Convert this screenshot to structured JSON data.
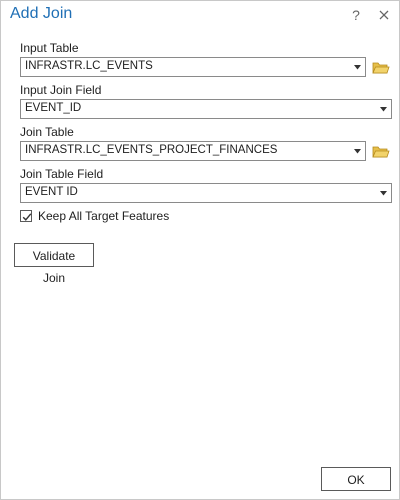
{
  "dialog": {
    "title": "Add Join",
    "help": "?"
  },
  "form": {
    "input_table": {
      "label": "Input Table",
      "value": "INFRASTR.LC_EVENTS"
    },
    "input_join_field": {
      "label": "Input Join Field",
      "value": "EVENT_ID"
    },
    "join_table": {
      "label": "Join Table",
      "value": "INFRASTR.LC_EVENTS_PROJECT_FINANCES"
    },
    "join_table_field": {
      "label": "Join Table Field",
      "value": "EVENT ID"
    },
    "keep_all": {
      "label": "Keep All Target Features",
      "checked": true
    }
  },
  "buttons": {
    "validate": "Validate Join",
    "ok": "OK"
  },
  "icons": {
    "help": "help-icon",
    "close": "close-icon",
    "dropdown": "chevron-down-icon",
    "browse": "folder-icon",
    "check": "checkmark-icon"
  },
  "colors": {
    "title": "#1f6fb5",
    "folder": "#d4a72c",
    "border": "#8a8a8a"
  }
}
